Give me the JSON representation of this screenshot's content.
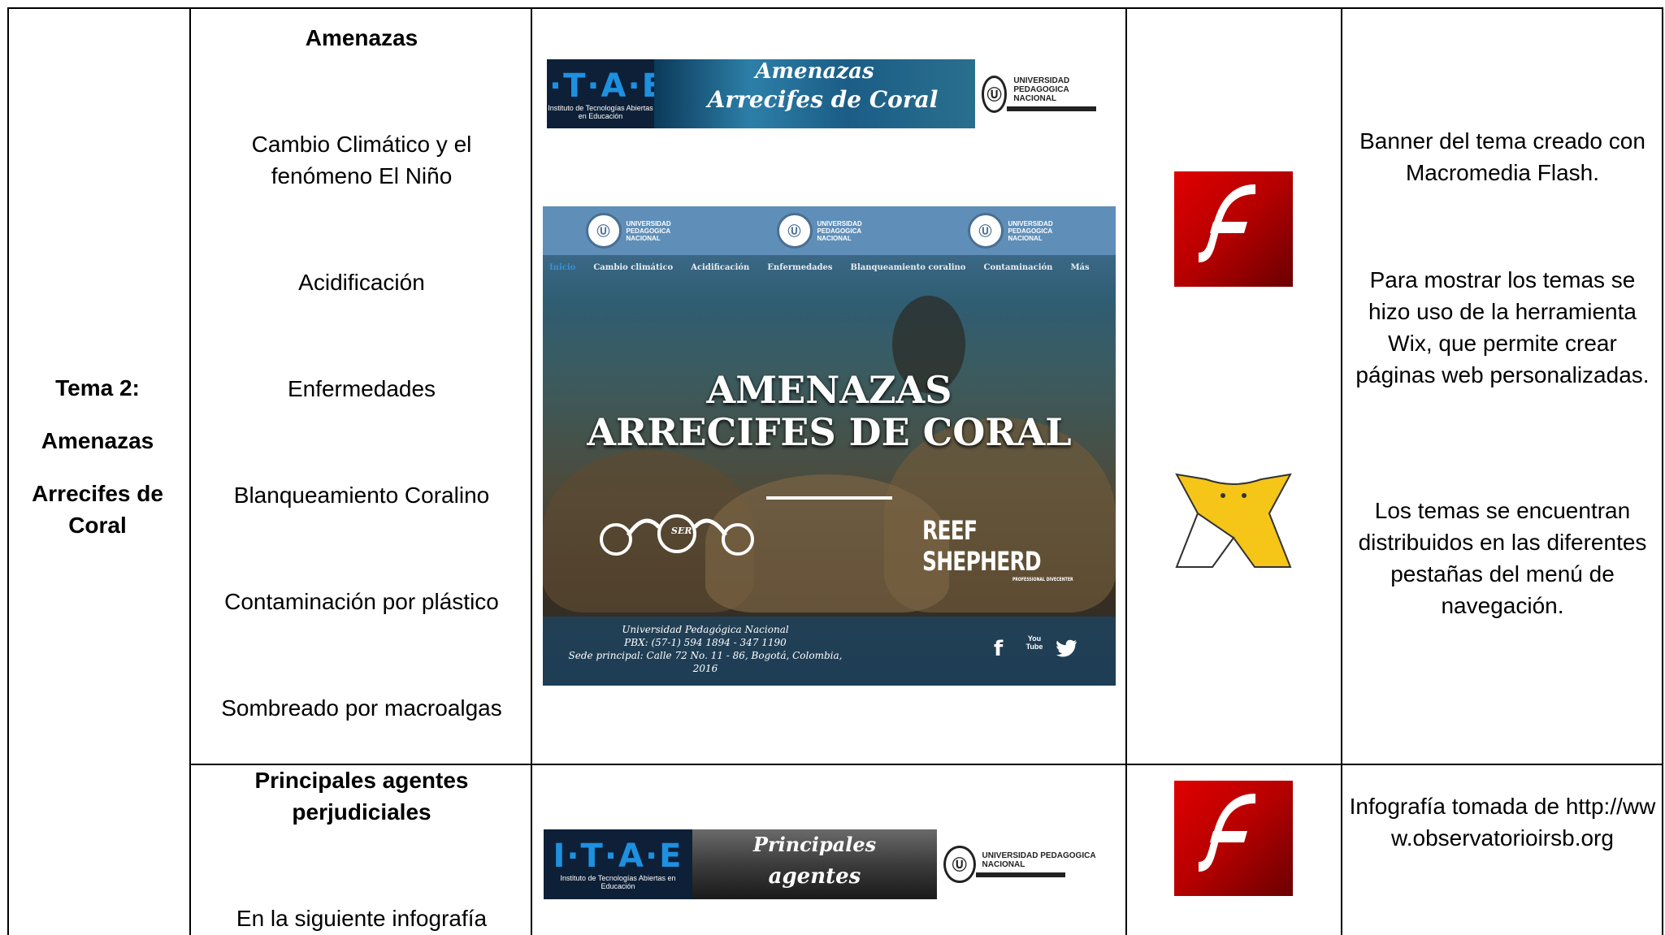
{
  "row1": {
    "topic": [
      "Tema 2:",
      "Amenazas",
      "Arrecifes de Coral"
    ],
    "section_heading": "Amenazas",
    "subtopics": [
      "Cambio Climático y el fenómeno El Niño",
      "Acidificación",
      "Enfermedades",
      "Blanqueamiento Coralino",
      "Contaminación por plástico",
      "Sombreado por macroalgas"
    ],
    "banner": {
      "itae_logo": "I·T·A·E",
      "itae_sub": "Instituto de Tecnologías Abiertas en Educación",
      "title_line1": "Amenazas",
      "title_line2": "Arrecifes de Coral",
      "upn_name": "UNIVERSIDAD PEDAGOGICA NACIONAL"
    },
    "site": {
      "header_logo_text": "UNIVERSIDAD PEDAGOGICA NACIONAL",
      "nav": [
        "Inicio",
        "Cambio climático",
        "Acidificación",
        "Enfermedades",
        "Blanqueamiento coralino",
        "Contaminación",
        "Más"
      ],
      "title_line1": "AMENAZAS",
      "title_line2": "ARRECIFES DE CORAL",
      "reef_shepherd": "REEF SHEPHERD",
      "reef_shepherd_sub": "PROFESSIONAL DIVECENTER",
      "ser_label": "SER",
      "footer_lines": [
        "Universidad Pedagógica Nacional",
        "PBX: (57-1) 594 1894 - 347 1190",
        "Sede principal: Calle 72 No. 11 - 86, Bogotá, Colombia,",
        "2016"
      ],
      "social": [
        "f",
        "You Tube",
        "twitter"
      ]
    },
    "icons": [
      "flash-icon",
      "wix-icon"
    ],
    "description": [
      "Banner del tema creado con Macromedia Flash.",
      "Para mostrar los temas se hizo uso de la herramienta Wix, que permite crear páginas web personalizadas.",
      "Los temas se encuentran distribuidos en las diferentes pestañas del menú de navegación."
    ]
  },
  "row2": {
    "section_heading": "Principales agentes perjudiciales",
    "text_start": "En la siguiente infografía",
    "banner": {
      "itae_logo": "I·T·A·E",
      "itae_sub": "Instituto de Tecnologías Abiertas en Educación",
      "title_line1": "Principales",
      "title_line2": "agentes perjudiciales",
      "upn_name": "UNIVERSIDAD PEDAGOGICA NACIONAL"
    },
    "description": "Infografía tomada de http://www.observatorioirsb.org"
  },
  "colors": {
    "border": "#000000",
    "flash_red": "#d10000",
    "wix_yellow": "#f5c518"
  }
}
